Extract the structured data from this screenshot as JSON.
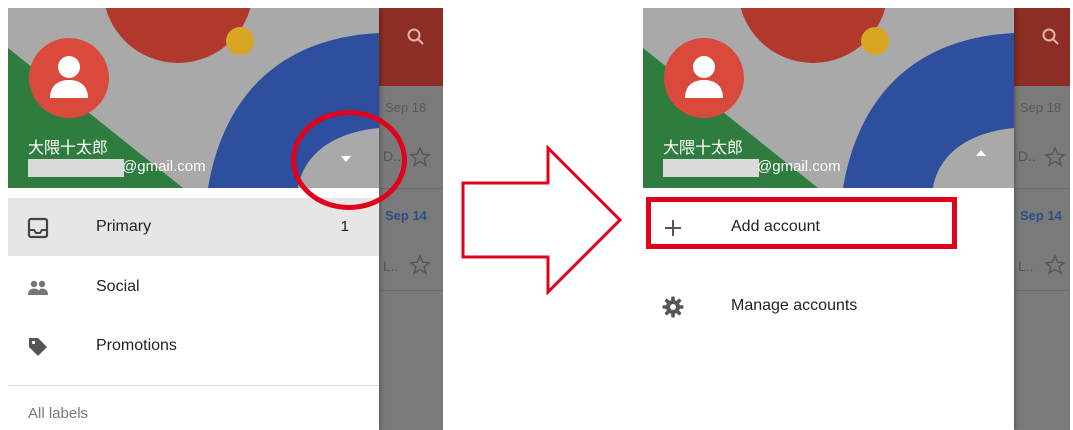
{
  "left": {
    "account": {
      "name": "大隈十太郎",
      "email_suffix": "@gmail.com"
    },
    "nav": [
      {
        "label": "Primary",
        "count": "1",
        "icon": "inbox-icon"
      },
      {
        "label": "Social",
        "icon": "people-icon"
      },
      {
        "label": "Promotions",
        "icon": "tag-icon"
      }
    ],
    "section_label": "All labels",
    "inbox": {
      "dates": [
        "Sep 18",
        "Sep 14"
      ],
      "snippets": [
        "D..",
        "L.."
      ]
    }
  },
  "right": {
    "account": {
      "name": "大隈十太郎",
      "email_suffix": "@gmail.com"
    },
    "menu": [
      {
        "label": "Add account",
        "icon": "plus-icon"
      },
      {
        "label": "Manage accounts",
        "icon": "gear-icon"
      }
    ],
    "inbox": {
      "dates": [
        "Sep 18",
        "Sep 14"
      ],
      "snippets": [
        "D..",
        "L.."
      ]
    }
  },
  "colors": {
    "highlight": "#e2001a",
    "avatar": "#d94a3d",
    "inbox_header": "#8c2e24"
  }
}
